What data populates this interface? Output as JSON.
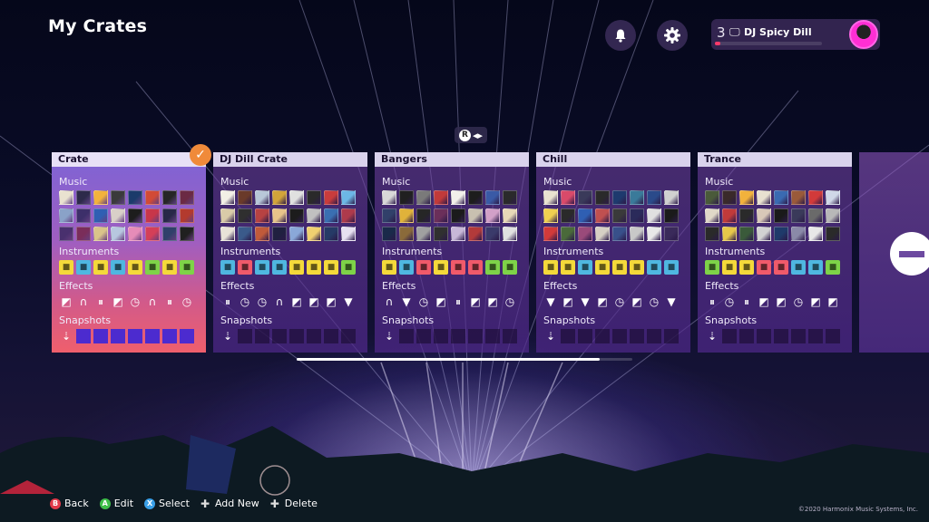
{
  "header": {
    "title": "My Crates",
    "notifications_icon": "bell-icon",
    "settings_icon": "gear-icon"
  },
  "profile": {
    "level": "3",
    "platform_icon": "monitor-icon",
    "name": "DJ Spicy Dill",
    "xp_fraction": 0.05,
    "avatar_color": "#ff2fd4"
  },
  "scroll_hint": {
    "button": "R",
    "arrows": "◂▸"
  },
  "labels": {
    "music": "Music",
    "instruments": "Instruments",
    "effects": "Effects",
    "snapshots": "Snapshots"
  },
  "crates": [
    {
      "name": "Crate",
      "selected": true,
      "music": [
        "#e9e2d0",
        "#2d2a4a",
        "#f2b23c",
        "#3a3a3a",
        "#1b3b6b",
        "#d24a36",
        "#262626",
        "#6b2a44",
        "#8aa2c8",
        "#3d2f6a",
        "#2f5fb3",
        "#d9d0c8",
        "#1d1d1d",
        "#c8364a",
        "#282848",
        "#b33a2e",
        "#49306e",
        "#7a2d5a",
        "#d9c48a",
        "#b7c7df",
        "#e68cb8",
        "#d43f58",
        "#30406a",
        "#202020"
      ],
      "instruments": [
        "#f4d93a",
        "#4fb7e0",
        "#f4d93a",
        "#4fb7e0",
        "#f4d93a",
        "#7ed348",
        "#f4d93a",
        "#7ed348"
      ],
      "effects": [
        "◩",
        "∩",
        "⏸",
        "◩",
        "◷",
        "∩",
        "⏸",
        "◷"
      ],
      "snapshots": 7
    },
    {
      "name": "DJ Dill Crate",
      "selected": false,
      "music": [
        "#f2efe6",
        "#6a3a2a",
        "#b8c7d8",
        "#d2a43a",
        "#e0e0e0",
        "#2a2a2a",
        "#c93c3c",
        "#6cb7e6",
        "#d9cba8",
        "#2f2f2f",
        "#b74242",
        "#e7c48a",
        "#1c1c1c",
        "#c0c0c0",
        "#3a6fb2",
        "#ad3a4c",
        "#e8e3d8",
        "#3a5a8a",
        "#c05a3a",
        "#202040",
        "#8aa8d8",
        "#f0d070",
        "#263a66",
        "#e6e0f0"
      ],
      "instruments": [
        "#4fb7e0",
        "#f05a6a",
        "#4fb7e0",
        "#4fb7e0",
        "#f4d93a",
        "#f4d93a",
        "#f4d93a",
        "#7ed348"
      ],
      "effects": [
        "⏸",
        "◷",
        "◷",
        "∩",
        "◩",
        "◩",
        "◩",
        "▼"
      ],
      "snapshots": 7
    },
    {
      "name": "Bangers",
      "selected": false,
      "music": [
        "#d8d8d8",
        "#202020",
        "#7a7a7a",
        "#c23a3a",
        "#f2f0ea",
        "#1d1d1d",
        "#3a5aa6",
        "#2a2a2a",
        "#31406a",
        "#e0b23a",
        "#262626",
        "#6b2f5a",
        "#1b1b1b",
        "#c8c0b0",
        "#d2a0c8",
        "#e8d8b8",
        "#1a2a4a",
        "#8a6a3a",
        "#a0a0a0",
        "#303030",
        "#c8b8d8",
        "#b23a3a",
        "#3a3a6a",
        "#e0e0e0"
      ],
      "instruments": [
        "#f4d93a",
        "#4fb7e0",
        "#f05a6a",
        "#f4d93a",
        "#f05a6a",
        "#f05a6a",
        "#7ed348",
        "#7ed348"
      ],
      "effects": [
        "∩",
        "▼",
        "◷",
        "◩",
        "⏸",
        "◩",
        "◩",
        "◷"
      ],
      "snapshots": 7
    },
    {
      "name": "Chill",
      "selected": false,
      "music": [
        "#e9e2d0",
        "#d94a6a",
        "#3a3a5a",
        "#2a2a2a",
        "#1e3a6e",
        "#3a7a9a",
        "#2a4a8a",
        "#d0d0d0",
        "#f0d050",
        "#2a2a2a",
        "#2f5fb3",
        "#c05050",
        "#3a3a3a",
        "#2a2a5a",
        "#e0e0e0",
        "#1a1a1a",
        "#d23a3a",
        "#4a6a3a",
        "#9a4a7a",
        "#d6d0c4",
        "#38508a",
        "#c8c8c8",
        "#e8e8e8",
        "#3a2a5a"
      ],
      "instruments": [
        "#f4d93a",
        "#f4d93a",
        "#4fb7e0",
        "#f4d93a",
        "#f4d93a",
        "#f4d93a",
        "#4fb7e0",
        "#4fb7e0"
      ],
      "effects": [
        "▼",
        "◩",
        "▼",
        "◩",
        "◷",
        "◩",
        "◷",
        "▼"
      ],
      "snapshots": 7
    },
    {
      "name": "Trance",
      "selected": false,
      "music": [
        "#4a5a3a",
        "#3a2a2a",
        "#f2b23c",
        "#e8e0d0",
        "#3a6ab2",
        "#9a5a3a",
        "#d23a3a",
        "#d0d8e8",
        "#e0d8c8",
        "#c03a3a",
        "#2a2a2a",
        "#d8c8b8",
        "#1a1a1a",
        "#3a3a5a",
        "#6a6a6a",
        "#b8b8b8",
        "#2a2a2a",
        "#e6c84a",
        "#3a5a3a",
        "#d2d2d2",
        "#1f3a6a",
        "#8a8aa8",
        "#e8e8e8",
        "#2a2a2a"
      ],
      "instruments": [
        "#7ed348",
        "#f4d93a",
        "#f4d93a",
        "#f05a6a",
        "#f05a6a",
        "#4fb7e0",
        "#4fb7e0",
        "#7ed348"
      ],
      "effects": [
        "⏸",
        "◷",
        "⏸",
        "◩",
        "◩",
        "◷",
        "◩",
        "◩"
      ],
      "snapshots": 7
    }
  ],
  "ghost_crate": {
    "icon": "minus-icon"
  },
  "scrollbar": {
    "position_fraction": 0.0
  },
  "footer": {
    "back": {
      "button": "B",
      "label": "Back",
      "color": "#e23a4a"
    },
    "edit": {
      "button": "A",
      "label": "Edit",
      "color": "#3fbf4a"
    },
    "select": {
      "button": "X",
      "label": "Select",
      "color": "#3aa0e8"
    },
    "add_new": {
      "icon": "dpad-icon",
      "label": "Add New"
    },
    "delete": {
      "icon": "dpad-icon",
      "label": "Delete"
    }
  },
  "copyright": "©2020 Harmonix Music Systems, Inc."
}
